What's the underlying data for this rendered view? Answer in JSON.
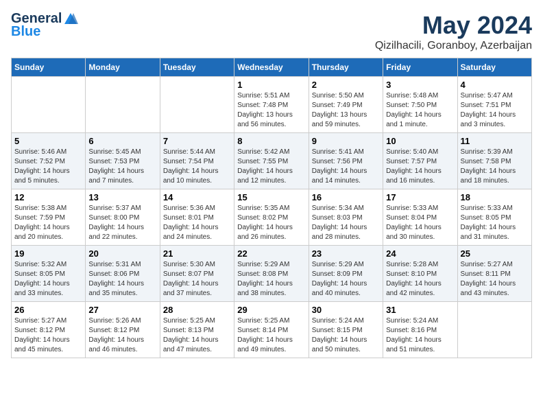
{
  "logo": {
    "general": "General",
    "blue": "Blue"
  },
  "title": {
    "month_year": "May 2024",
    "location": "Qizilhacili, Goranboy, Azerbaijan"
  },
  "days_header": [
    "Sunday",
    "Monday",
    "Tuesday",
    "Wednesday",
    "Thursday",
    "Friday",
    "Saturday"
  ],
  "weeks": [
    [
      {
        "day": "",
        "sunrise": "",
        "sunset": "",
        "daylight": ""
      },
      {
        "day": "",
        "sunrise": "",
        "sunset": "",
        "daylight": ""
      },
      {
        "day": "",
        "sunrise": "",
        "sunset": "",
        "daylight": ""
      },
      {
        "day": "1",
        "sunrise": "Sunrise: 5:51 AM",
        "sunset": "Sunset: 7:48 PM",
        "daylight": "Daylight: 13 hours and 56 minutes."
      },
      {
        "day": "2",
        "sunrise": "Sunrise: 5:50 AM",
        "sunset": "Sunset: 7:49 PM",
        "daylight": "Daylight: 13 hours and 59 minutes."
      },
      {
        "day": "3",
        "sunrise": "Sunrise: 5:48 AM",
        "sunset": "Sunset: 7:50 PM",
        "daylight": "Daylight: 14 hours and 1 minute."
      },
      {
        "day": "4",
        "sunrise": "Sunrise: 5:47 AM",
        "sunset": "Sunset: 7:51 PM",
        "daylight": "Daylight: 14 hours and 3 minutes."
      }
    ],
    [
      {
        "day": "5",
        "sunrise": "Sunrise: 5:46 AM",
        "sunset": "Sunset: 7:52 PM",
        "daylight": "Daylight: 14 hours and 5 minutes."
      },
      {
        "day": "6",
        "sunrise": "Sunrise: 5:45 AM",
        "sunset": "Sunset: 7:53 PM",
        "daylight": "Daylight: 14 hours and 7 minutes."
      },
      {
        "day": "7",
        "sunrise": "Sunrise: 5:44 AM",
        "sunset": "Sunset: 7:54 PM",
        "daylight": "Daylight: 14 hours and 10 minutes."
      },
      {
        "day": "8",
        "sunrise": "Sunrise: 5:42 AM",
        "sunset": "Sunset: 7:55 PM",
        "daylight": "Daylight: 14 hours and 12 minutes."
      },
      {
        "day": "9",
        "sunrise": "Sunrise: 5:41 AM",
        "sunset": "Sunset: 7:56 PM",
        "daylight": "Daylight: 14 hours and 14 minutes."
      },
      {
        "day": "10",
        "sunrise": "Sunrise: 5:40 AM",
        "sunset": "Sunset: 7:57 PM",
        "daylight": "Daylight: 14 hours and 16 minutes."
      },
      {
        "day": "11",
        "sunrise": "Sunrise: 5:39 AM",
        "sunset": "Sunset: 7:58 PM",
        "daylight": "Daylight: 14 hours and 18 minutes."
      }
    ],
    [
      {
        "day": "12",
        "sunrise": "Sunrise: 5:38 AM",
        "sunset": "Sunset: 7:59 PM",
        "daylight": "Daylight: 14 hours and 20 minutes."
      },
      {
        "day": "13",
        "sunrise": "Sunrise: 5:37 AM",
        "sunset": "Sunset: 8:00 PM",
        "daylight": "Daylight: 14 hours and 22 minutes."
      },
      {
        "day": "14",
        "sunrise": "Sunrise: 5:36 AM",
        "sunset": "Sunset: 8:01 PM",
        "daylight": "Daylight: 14 hours and 24 minutes."
      },
      {
        "day": "15",
        "sunrise": "Sunrise: 5:35 AM",
        "sunset": "Sunset: 8:02 PM",
        "daylight": "Daylight: 14 hours and 26 minutes."
      },
      {
        "day": "16",
        "sunrise": "Sunrise: 5:34 AM",
        "sunset": "Sunset: 8:03 PM",
        "daylight": "Daylight: 14 hours and 28 minutes."
      },
      {
        "day": "17",
        "sunrise": "Sunrise: 5:33 AM",
        "sunset": "Sunset: 8:04 PM",
        "daylight": "Daylight: 14 hours and 30 minutes."
      },
      {
        "day": "18",
        "sunrise": "Sunrise: 5:33 AM",
        "sunset": "Sunset: 8:05 PM",
        "daylight": "Daylight: 14 hours and 31 minutes."
      }
    ],
    [
      {
        "day": "19",
        "sunrise": "Sunrise: 5:32 AM",
        "sunset": "Sunset: 8:05 PM",
        "daylight": "Daylight: 14 hours and 33 minutes."
      },
      {
        "day": "20",
        "sunrise": "Sunrise: 5:31 AM",
        "sunset": "Sunset: 8:06 PM",
        "daylight": "Daylight: 14 hours and 35 minutes."
      },
      {
        "day": "21",
        "sunrise": "Sunrise: 5:30 AM",
        "sunset": "Sunset: 8:07 PM",
        "daylight": "Daylight: 14 hours and 37 minutes."
      },
      {
        "day": "22",
        "sunrise": "Sunrise: 5:29 AM",
        "sunset": "Sunset: 8:08 PM",
        "daylight": "Daylight: 14 hours and 38 minutes."
      },
      {
        "day": "23",
        "sunrise": "Sunrise: 5:29 AM",
        "sunset": "Sunset: 8:09 PM",
        "daylight": "Daylight: 14 hours and 40 minutes."
      },
      {
        "day": "24",
        "sunrise": "Sunrise: 5:28 AM",
        "sunset": "Sunset: 8:10 PM",
        "daylight": "Daylight: 14 hours and 42 minutes."
      },
      {
        "day": "25",
        "sunrise": "Sunrise: 5:27 AM",
        "sunset": "Sunset: 8:11 PM",
        "daylight": "Daylight: 14 hours and 43 minutes."
      }
    ],
    [
      {
        "day": "26",
        "sunrise": "Sunrise: 5:27 AM",
        "sunset": "Sunset: 8:12 PM",
        "daylight": "Daylight: 14 hours and 45 minutes."
      },
      {
        "day": "27",
        "sunrise": "Sunrise: 5:26 AM",
        "sunset": "Sunset: 8:12 PM",
        "daylight": "Daylight: 14 hours and 46 minutes."
      },
      {
        "day": "28",
        "sunrise": "Sunrise: 5:25 AM",
        "sunset": "Sunset: 8:13 PM",
        "daylight": "Daylight: 14 hours and 47 minutes."
      },
      {
        "day": "29",
        "sunrise": "Sunrise: 5:25 AM",
        "sunset": "Sunset: 8:14 PM",
        "daylight": "Daylight: 14 hours and 49 minutes."
      },
      {
        "day": "30",
        "sunrise": "Sunrise: 5:24 AM",
        "sunset": "Sunset: 8:15 PM",
        "daylight": "Daylight: 14 hours and 50 minutes."
      },
      {
        "day": "31",
        "sunrise": "Sunrise: 5:24 AM",
        "sunset": "Sunset: 8:16 PM",
        "daylight": "Daylight: 14 hours and 51 minutes."
      },
      {
        "day": "",
        "sunrise": "",
        "sunset": "",
        "daylight": ""
      }
    ]
  ]
}
